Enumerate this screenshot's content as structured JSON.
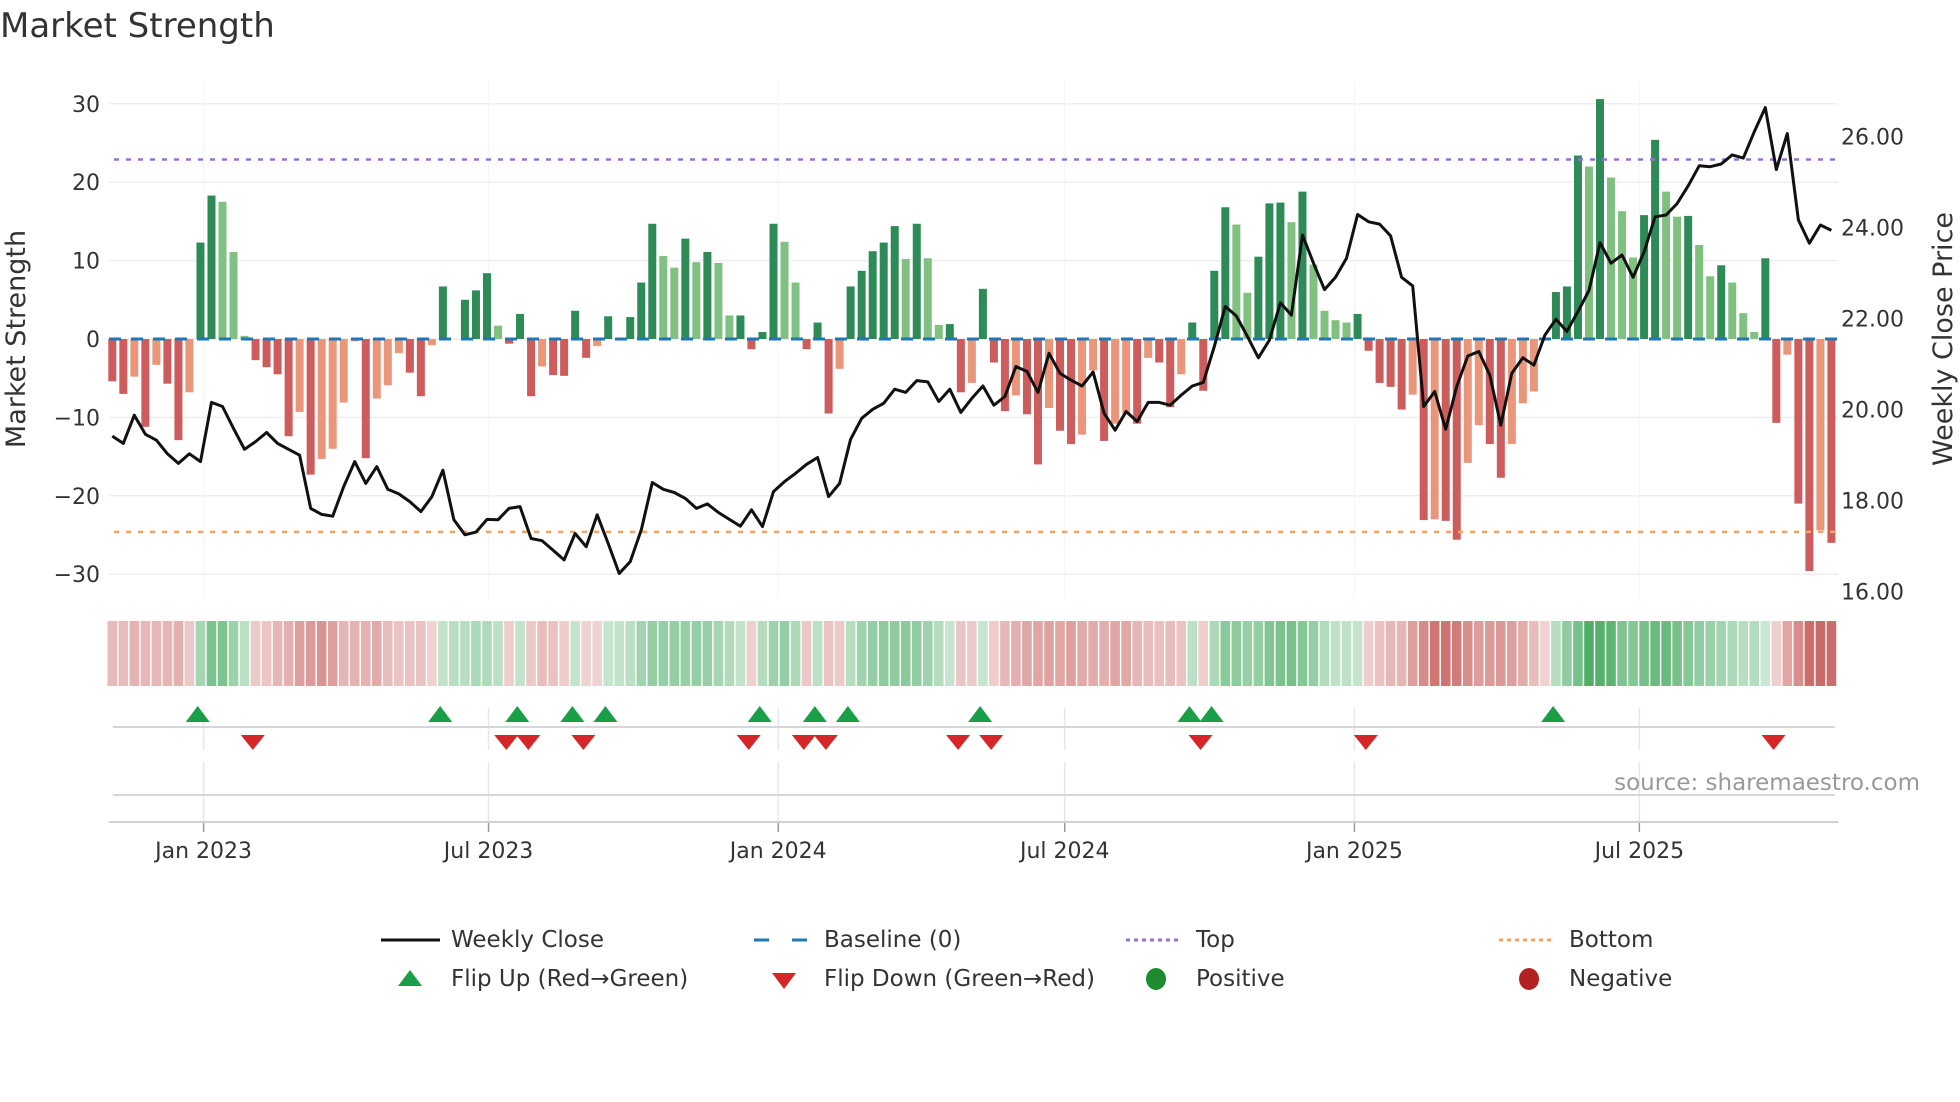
{
  "chart_data": {
    "type": "bar+line",
    "title": "Market Strength",
    "ylabel": "Market Strength",
    "y2label": "Weekly Close Price",
    "ylim": [
      -33,
      33
    ],
    "y2lim": [
      15.86,
      27.2
    ],
    "start_date": "2022-11-04",
    "step_days": 7,
    "left_ticks": [
      {
        "value": 30,
        "label": "30"
      },
      {
        "value": 20,
        "label": "20"
      },
      {
        "value": 10,
        "label": "10"
      },
      {
        "value": 0,
        "label": "0"
      },
      {
        "value": -10,
        "label": "−10"
      },
      {
        "value": -20,
        "label": "−20"
      },
      {
        "value": -30,
        "label": "−30"
      }
    ],
    "right_ticks": [
      {
        "value": 26,
        "label": "26.00"
      },
      {
        "value": 24,
        "label": "24.00"
      },
      {
        "value": 22,
        "label": "22.00"
      },
      {
        "value": 20,
        "label": "20.00"
      },
      {
        "value": 18,
        "label": "18.00"
      },
      {
        "value": 16,
        "label": "16.00"
      }
    ],
    "x_ticks": [
      {
        "date": "2023-01-01",
        "label": "Jan 2023"
      },
      {
        "date": "2023-07-01",
        "label": "Jul 2023"
      },
      {
        "date": "2024-01-01",
        "label": "Jan 2024"
      },
      {
        "date": "2024-07-01",
        "label": "Jul 2024"
      },
      {
        "date": "2025-01-01",
        "label": "Jan 2025"
      },
      {
        "date": "2025-07-01",
        "label": "Jul 2025"
      }
    ],
    "top_threshold": 22.9,
    "bottom_threshold": -24.6,
    "baseline": 0,
    "strength": [
      -5.4,
      -7,
      -4.8,
      -11.2,
      -3.3,
      -5.7,
      -12.9,
      -6.8,
      12.3,
      18.3,
      17.5,
      11.1,
      0.4,
      -2.7,
      -3.6,
      -4.5,
      -12.4,
      -9.3,
      -17.3,
      -15.3,
      -14,
      -8.1,
      -0.3,
      -15.2,
      -7.6,
      -5.9,
      -1.8,
      -4.3,
      -7.3,
      -0.8,
      6.7,
      0,
      5,
      6.2,
      8.4,
      1.7,
      -0.6,
      3.2,
      -7.3,
      -3.5,
      -4.6,
      -4.7,
      3.6,
      -2.4,
      -0.9,
      2.9,
      0,
      2.8,
      7.2,
      14.7,
      10.6,
      9.1,
      12.8,
      9.8,
      11.1,
      9.7,
      3,
      3,
      -1.3,
      0.9,
      14.7,
      12.4,
      7.2,
      -1.3,
      2.1,
      -9.5,
      -3.8,
      6.7,
      8.7,
      11.2,
      12.3,
      14.4,
      10.2,
      14.7,
      10.3,
      1.8,
      1.9,
      -6.8,
      -5.6,
      6.4,
      -3,
      -9.2,
      -7.2,
      -9.6,
      -16,
      -8.8,
      -11.7,
      -13.4,
      -12.2,
      -4,
      -13,
      -10.8,
      -9.5,
      -10.8,
      -2.4,
      -3,
      -8.7,
      -4.5,
      2.1,
      -6.6,
      8.7,
      16.8,
      14.6,
      5.9,
      10.5,
      17.3,
      17.4,
      14.9,
      18.8,
      9.5,
      3.6,
      2.4,
      2.1,
      3.2,
      -1.5,
      -5.6,
      -6.1,
      -9,
      -7.1,
      -23.1,
      -23,
      -23.2,
      -25.6,
      -15.8,
      -11,
      -13.4,
      -17.7,
      -13.4,
      -8.2,
      -6.7,
      -0.2,
      6,
      6.7,
      23.4,
      22,
      30.6,
      20.6,
      16.3,
      10.4,
      15.8,
      25.4,
      18.8,
      15.6,
      15.7,
      12,
      8,
      9.4,
      7.2,
      3.3,
      0.9,
      10.3,
      -10.7,
      -2,
      -21,
      -29.6,
      -24.4,
      -26
    ],
    "weekly_close": [
      19.41,
      19.25,
      19.87,
      19.45,
      19.32,
      19.02,
      18.81,
      19.02,
      18.85,
      20.15,
      20.06,
      19.58,
      19.12,
      19.29,
      19.49,
      19.25,
      19.12,
      18.99,
      17.82,
      17.69,
      17.65,
      18.3,
      18.85,
      18.37,
      18.74,
      18.24,
      18.14,
      17.97,
      17.75,
      18.08,
      18.66,
      17.57,
      17.24,
      17.3,
      17.58,
      17.57,
      17.82,
      17.86,
      17.16,
      17.11,
      16.9,
      16.69,
      17.27,
      16.98,
      17.68,
      17.05,
      16.39,
      16.65,
      17.35,
      18.39,
      18.24,
      18.17,
      18.04,
      17.82,
      17.92,
      17.73,
      17.58,
      17.43,
      17.79,
      17.42,
      18.19,
      18.41,
      18.59,
      18.79,
      18.94,
      18.08,
      18.37,
      19.34,
      19.8,
      20.0,
      20.13,
      20.44,
      20.37,
      20.63,
      20.6,
      20.17,
      20.44,
      19.93,
      20.24,
      20.51,
      20.09,
      20.28,
      20.94,
      20.83,
      20.37,
      21.23,
      20.79,
      20.64,
      20.51,
      20.82,
      19.91,
      19.54,
      19.95,
      19.73,
      20.15,
      20.15,
      20.09,
      20.31,
      20.51,
      20.59,
      21.38,
      22.26,
      22.05,
      21.6,
      21.13,
      21.52,
      22.34,
      22.07,
      23.83,
      23.21,
      22.63,
      22.9,
      23.32,
      24.28,
      24.12,
      24.07,
      23.81,
      22.9,
      22.71,
      20.06,
      20.39,
      19.56,
      20.5,
      21.17,
      21.27,
      20.75,
      19.65,
      20.79,
      21.13,
      20.97,
      21.63,
      21.98,
      21.71,
      22.15,
      22.61,
      23.66,
      23.21,
      23.39,
      22.9,
      23.46,
      24.23,
      24.27,
      24.52,
      24.91,
      25.35,
      25.33,
      25.39,
      25.59,
      25.52,
      26.1,
      26.63,
      25.27,
      26.06,
      24.16,
      23.65,
      24.05,
      23.93
    ],
    "flip_up_weeks": [
      8,
      30,
      37,
      42,
      45,
      59,
      64,
      67,
      79,
      98,
      100,
      131
    ],
    "flip_down_weeks": [
      13,
      36,
      38,
      43,
      58,
      63,
      65,
      77,
      80,
      99,
      114,
      151
    ],
    "colors": {
      "pos_strong": "#2e8b57",
      "pos_weak": "#80c080",
      "neg_strong": "#cd5c5c",
      "neg_weak": "#e9967a",
      "baseline": "#1f77b4",
      "top": "#9370db",
      "bottom": "#f4a460",
      "flip_up": "#1a9e47",
      "flip_down": "#d62728",
      "heat_pos": "#2e9e4a",
      "heat_neg": "#c0504d",
      "positive_dot": "#1e8c2e",
      "negative_dot": "#b22222",
      "price_line": "#111111"
    },
    "legend": [
      {
        "label": "Weekly Close",
        "symbol": "line"
      },
      {
        "label": "Baseline (0)",
        "symbol": "dash"
      },
      {
        "label": "Top",
        "symbol": "dot-purple"
      },
      {
        "label": "Bottom",
        "symbol": "dot-orange"
      },
      {
        "label": "Flip Up (Red→Green)",
        "symbol": "triangle-up"
      },
      {
        "label": "Flip Down (Green→Red)",
        "symbol": "triangle-down"
      },
      {
        "label": "Positive",
        "symbol": "circle-green"
      },
      {
        "label": "Negative",
        "symbol": "circle-red"
      }
    ],
    "source": "source: sharemaestro.com"
  }
}
